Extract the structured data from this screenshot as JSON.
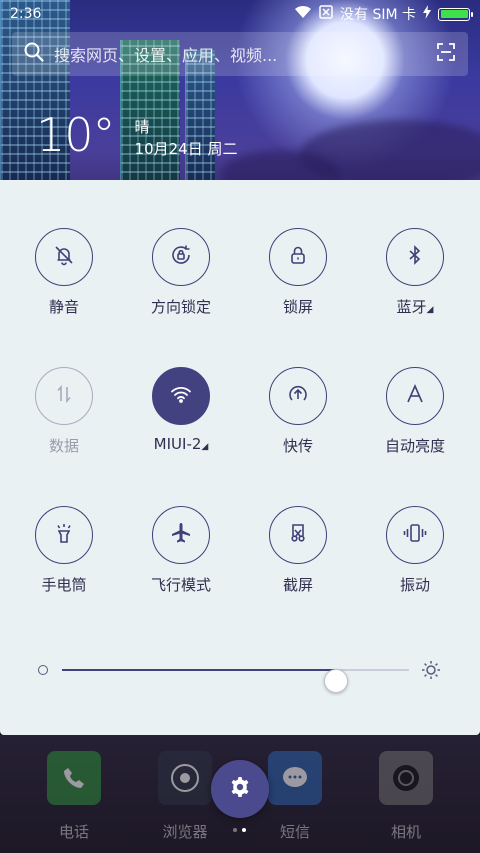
{
  "status_bar": {
    "time": "2:36",
    "carrier": "没有 SIM 卡",
    "battery_level": 1.0
  },
  "search": {
    "placeholder": "搜索网页、设置、应用、视频..."
  },
  "weather": {
    "temperature": "10°",
    "condition": "晴",
    "date": "10月24日 周二"
  },
  "quick_settings": {
    "tiles": [
      {
        "label": "静音",
        "icon": "bell-off-icon",
        "state": "off"
      },
      {
        "label": "方向锁定",
        "icon": "rotation-lock-icon",
        "state": "off"
      },
      {
        "label": "锁屏",
        "icon": "lock-icon",
        "state": "off"
      },
      {
        "label": "蓝牙",
        "icon": "bluetooth-icon",
        "state": "off"
      },
      {
        "label": "数据",
        "icon": "mobile-data-icon",
        "state": "disabled"
      },
      {
        "label": "MIUI-2",
        "icon": "wifi-icon",
        "state": "on"
      },
      {
        "label": "快传",
        "icon": "quick-transfer-icon",
        "state": "off"
      },
      {
        "label": "自动亮度",
        "icon": "auto-brightness-icon",
        "state": "off"
      },
      {
        "label": "手电筒",
        "icon": "flashlight-icon",
        "state": "off"
      },
      {
        "label": "飞行模式",
        "icon": "airplane-icon",
        "state": "off"
      },
      {
        "label": "截屏",
        "icon": "screenshot-icon",
        "state": "off"
      },
      {
        "label": "振动",
        "icon": "vibrate-icon",
        "state": "off"
      }
    ],
    "brightness_level": 0.79
  },
  "dock": {
    "apps": [
      {
        "label": "电话",
        "icon": "phone-icon"
      },
      {
        "label": "浏览器",
        "icon": "browser-icon"
      },
      {
        "label": "短信",
        "icon": "message-icon"
      },
      {
        "label": "相机",
        "icon": "camera-icon"
      }
    ]
  },
  "colors": {
    "accent": "#41427f",
    "panel_bg": "#eaf1f3",
    "battery": "#3fe04a"
  }
}
